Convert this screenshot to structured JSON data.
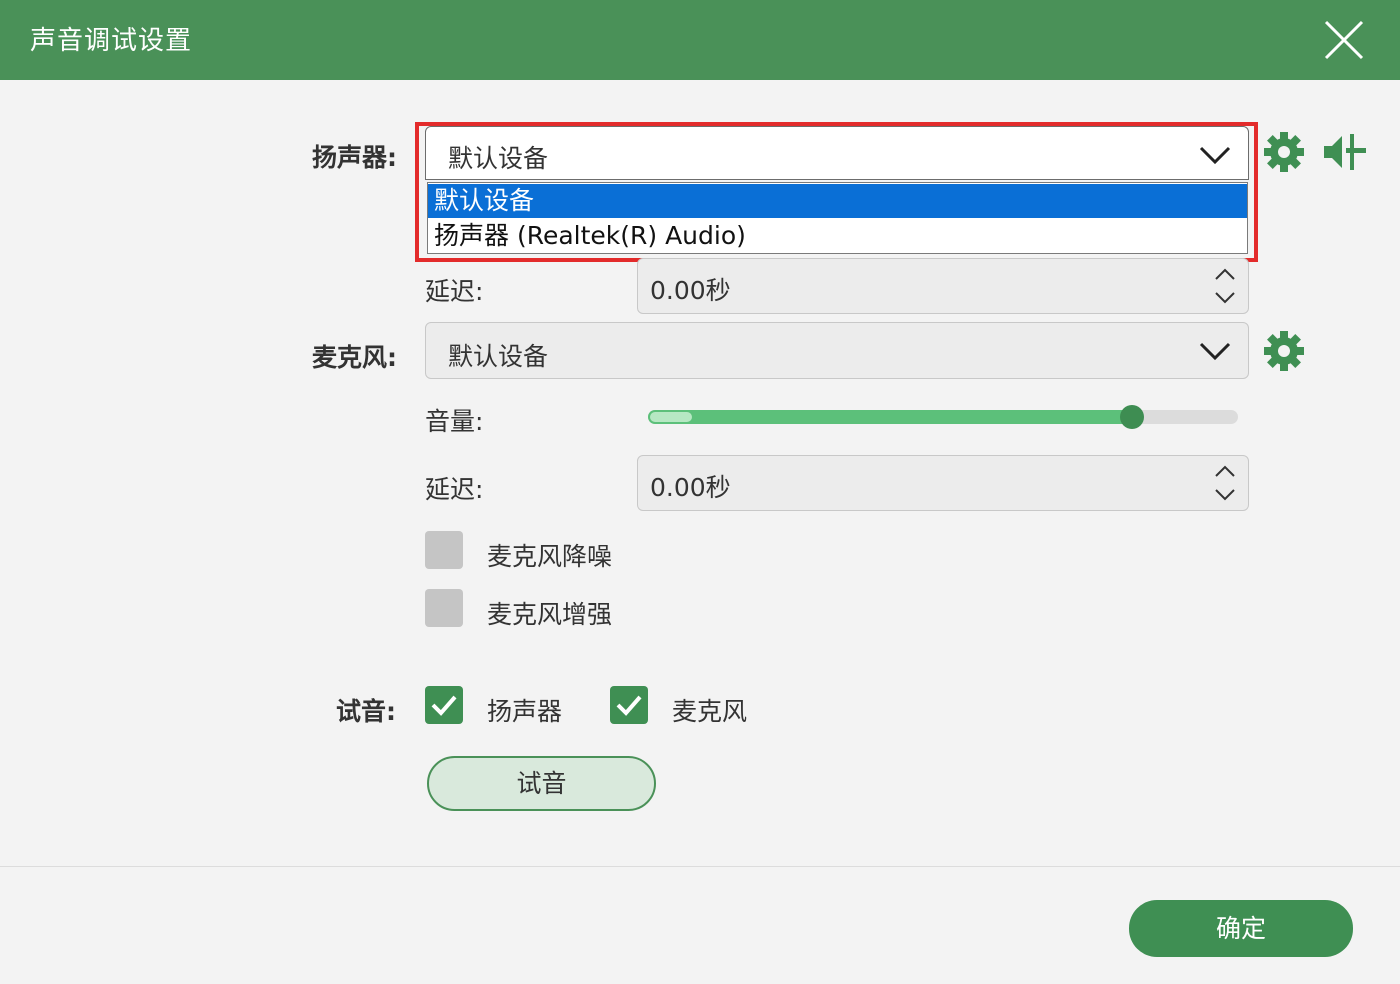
{
  "window": {
    "title": "声音调试设置"
  },
  "speaker": {
    "label": "扬声器:",
    "selected": "默认设备",
    "options": [
      "默认设备",
      "扬声器 (Realtek(R) Audio)"
    ],
    "delay_label": "延迟:",
    "delay_value": "0.00秒"
  },
  "microphone": {
    "label": "麦克风:",
    "selected": "默认设备",
    "volume_label": "音量:",
    "volume_fraction": 0.82,
    "delay_label": "延迟:",
    "delay_value": "0.00秒",
    "noise_reduction_label": "麦克风降噪",
    "noise_reduction_checked": false,
    "enhance_label": "麦克风增强",
    "enhance_checked": false
  },
  "test": {
    "label": "试音:",
    "speaker_label": "扬声器",
    "speaker_checked": true,
    "mic_label": "麦克风",
    "mic_checked": true,
    "button_label": "试音"
  },
  "footer": {
    "ok_label": "确定"
  },
  "colors": {
    "header": "#4a9158",
    "accent": "#3f8f53",
    "selection": "#0a6fd6",
    "highlight": "#e32b2b"
  }
}
